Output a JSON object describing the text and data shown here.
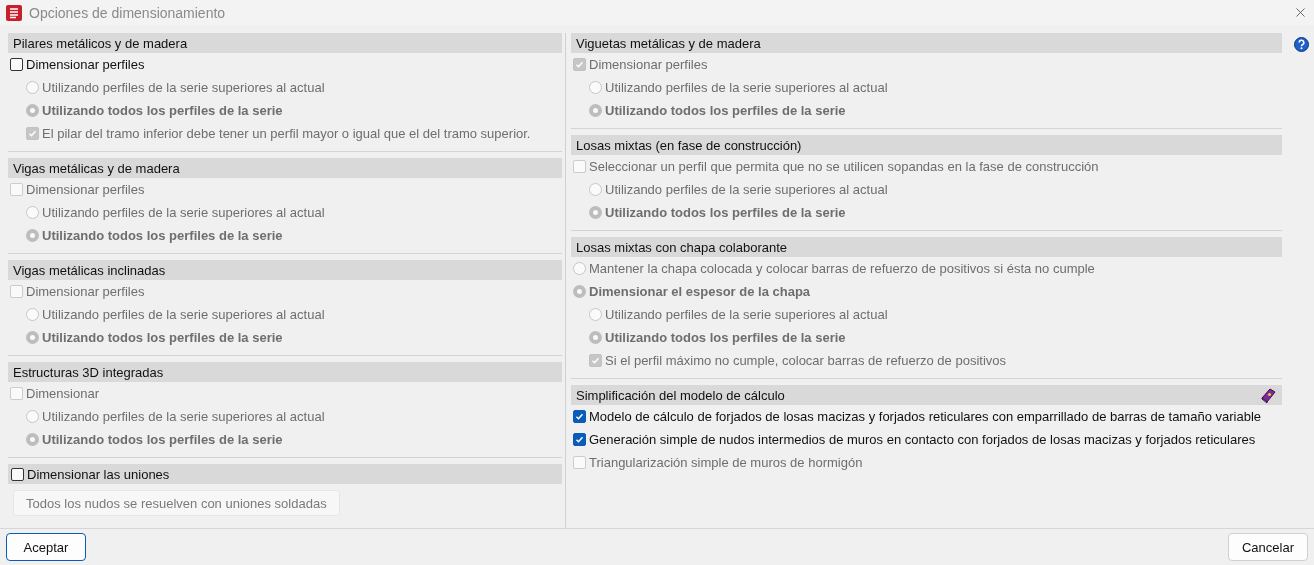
{
  "window": {
    "title": "Opciones de dimensionamiento"
  },
  "columns": [
    {
      "sections": [
        {
          "title": "Pilares metálicos y de madera",
          "items": [
            {
              "kind": "checkbox",
              "label": "Dimensionar perfiles",
              "checked": false,
              "disabled": false,
              "children": [
                {
                  "kind": "radio",
                  "label": "Utilizando perfiles de la serie superiores al actual",
                  "selected": false,
                  "disabled": true
                },
                {
                  "kind": "radio",
                  "label": "Utilizando todos los perfiles de la serie",
                  "selected": true,
                  "disabled": true
                },
                {
                  "kind": "checkbox",
                  "label": "El pilar del tramo inferior debe tener un perfil mayor o igual que el del tramo superior.",
                  "checked": true,
                  "disabled": true
                }
              ]
            }
          ]
        },
        {
          "title": "Vigas metálicas y de madera",
          "items": [
            {
              "kind": "checkbox",
              "label": "Dimensionar perfiles",
              "checked": false,
              "disabled": true,
              "children": [
                {
                  "kind": "radio",
                  "label": "Utilizando perfiles de la serie superiores al actual",
                  "selected": false,
                  "disabled": true
                },
                {
                  "kind": "radio",
                  "label": "Utilizando todos los perfiles de la serie",
                  "selected": true,
                  "disabled": true
                }
              ]
            }
          ]
        },
        {
          "title": "Vigas metálicas inclinadas",
          "items": [
            {
              "kind": "checkbox",
              "label": "Dimensionar perfiles",
              "checked": false,
              "disabled": true,
              "children": [
                {
                  "kind": "radio",
                  "label": "Utilizando perfiles de la serie superiores al actual",
                  "selected": false,
                  "disabled": true
                },
                {
                  "kind": "radio",
                  "label": "Utilizando todos los perfiles de la serie",
                  "selected": true,
                  "disabled": true
                }
              ]
            }
          ]
        },
        {
          "title": "Estructuras 3D integradas",
          "items": [
            {
              "kind": "checkbox",
              "label": "Dimensionar",
              "checked": false,
              "disabled": true,
              "children": [
                {
                  "kind": "radio",
                  "label": "Utilizando perfiles de la serie superiores al actual",
                  "selected": false,
                  "disabled": true
                },
                {
                  "kind": "radio",
                  "label": "Utilizando todos los perfiles de la serie",
                  "selected": true,
                  "disabled": true
                }
              ]
            }
          ]
        },
        {
          "title": "Dimensionar las uniones",
          "header_checked": false,
          "items": [
            {
              "kind": "button",
              "label": "Todos los nudos se resuelven con uniones soldadas",
              "disabled": true
            }
          ]
        }
      ]
    },
    {
      "sections": [
        {
          "title": "Viguetas metálicas y de madera",
          "items": [
            {
              "kind": "checkbox",
              "label": "Dimensionar perfiles",
              "checked": true,
              "disabled": true,
              "children": [
                {
                  "kind": "radio",
                  "label": "Utilizando perfiles de la serie superiores al actual",
                  "selected": false,
                  "disabled": true
                },
                {
                  "kind": "radio",
                  "label": "Utilizando todos los perfiles de la serie",
                  "selected": true,
                  "disabled": true
                }
              ]
            }
          ]
        },
        {
          "title": "Losas mixtas (en fase de construcción)",
          "items": [
            {
              "kind": "checkbox",
              "label": "Seleccionar un perfil que permita que no se utilicen sopandas en la fase de construcción",
              "checked": false,
              "disabled": true,
              "children": [
                {
                  "kind": "radio",
                  "label": "Utilizando perfiles de la serie superiores al actual",
                  "selected": false,
                  "disabled": true
                },
                {
                  "kind": "radio",
                  "label": "Utilizando todos los perfiles de la serie",
                  "selected": true,
                  "disabled": true
                }
              ]
            }
          ]
        },
        {
          "title": "Losas mixtas con chapa colaborante",
          "items": [
            {
              "kind": "radio",
              "label": "Mantener la chapa colocada y colocar barras de refuerzo de positivos si ésta no cumple",
              "selected": false,
              "disabled": true
            },
            {
              "kind": "radio",
              "label": "Dimensionar el espesor de la chapa",
              "selected": true,
              "disabled": true,
              "children": [
                {
                  "kind": "radio",
                  "label": "Utilizando perfiles de la serie superiores al actual",
                  "selected": false,
                  "disabled": true
                },
                {
                  "kind": "radio",
                  "label": "Utilizando todos los perfiles de la serie",
                  "selected": true,
                  "disabled": true
                },
                {
                  "kind": "checkbox",
                  "label": "Si el perfil máximo no cumple, colocar barras de refuerzo de positivos",
                  "checked": true,
                  "disabled": true
                }
              ]
            }
          ]
        },
        {
          "title": "Simplificación del modelo de cálculo",
          "help_book": true,
          "items": [
            {
              "kind": "checkbox",
              "label": "Modelo de cálculo de forjados de losas macizas y forjados reticulares con emparrillado de barras de tamaño variable",
              "checked": true,
              "disabled": false
            },
            {
              "kind": "checkbox",
              "label": "Generación simple de nudos intermedios de muros en contacto con forjados de losas macizas y forjados reticulares",
              "checked": true,
              "disabled": false
            },
            {
              "kind": "checkbox",
              "label": "Triangularización simple de muros de hormigón",
              "checked": false,
              "disabled": true
            }
          ]
        }
      ]
    }
  ],
  "buttons": [
    {
      "label": "Aceptar",
      "focused": true
    },
    {
      "label": "Cancelar",
      "focused": false
    }
  ]
}
